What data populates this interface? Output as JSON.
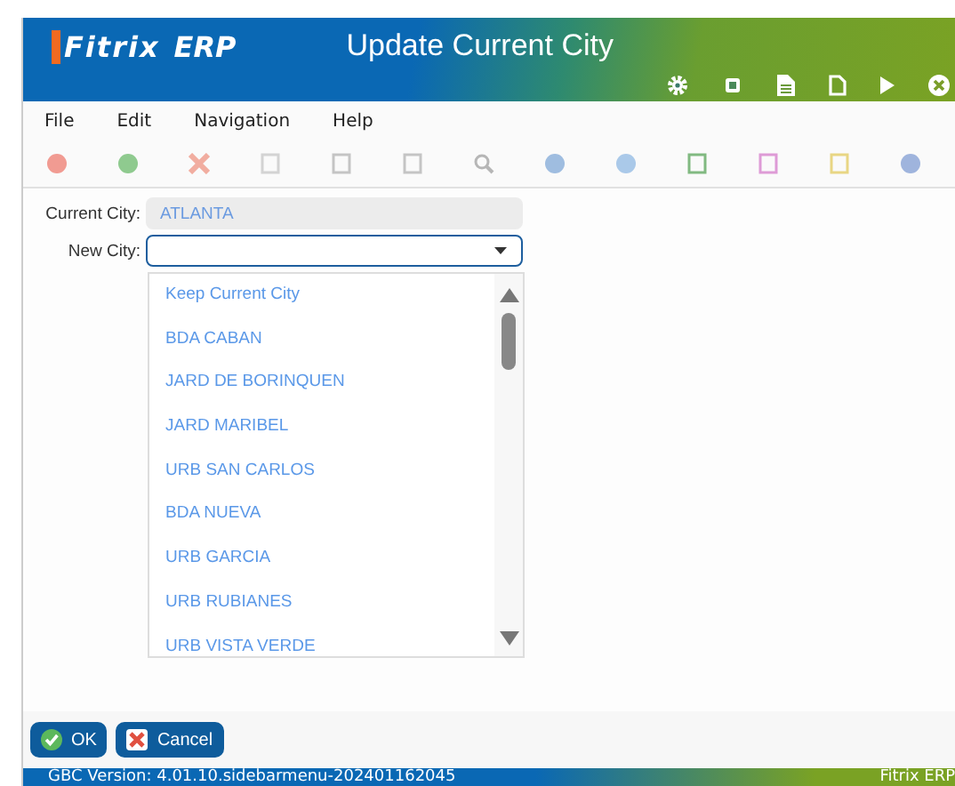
{
  "header": {
    "logo": "Fitrix",
    "logo_suffix": "ERP",
    "title": "Update Current City"
  },
  "menu": [
    "File",
    "Edit",
    "Navigation",
    "Help"
  ],
  "form": {
    "current_city_label": "Current City:",
    "current_city": "ATLANTA",
    "new_city_label": "New City:",
    "options": [
      {
        "label": "Keep Current City"
      },
      {
        "label": "BDA CABAN"
      },
      {
        "label": "JARD DE BORINQUEN"
      },
      {
        "label": "JARD MARIBEL"
      },
      {
        "label": "URB SAN CARLOS"
      },
      {
        "label": "BDA NUEVA"
      },
      {
        "label": "URB GARCIA"
      },
      {
        "label": "URB RUBIANES"
      },
      {
        "label": "URB VISTA VERDE"
      }
    ]
  },
  "buttons": [
    {
      "kind": "ok",
      "label": "OK"
    },
    {
      "kind": "cancel",
      "label": "Cancel"
    }
  ],
  "status_bar": {
    "version": "GBC Version: 4.01.10.sidebarmenu-202401162045",
    "app": "Fitrix ERP"
  }
}
